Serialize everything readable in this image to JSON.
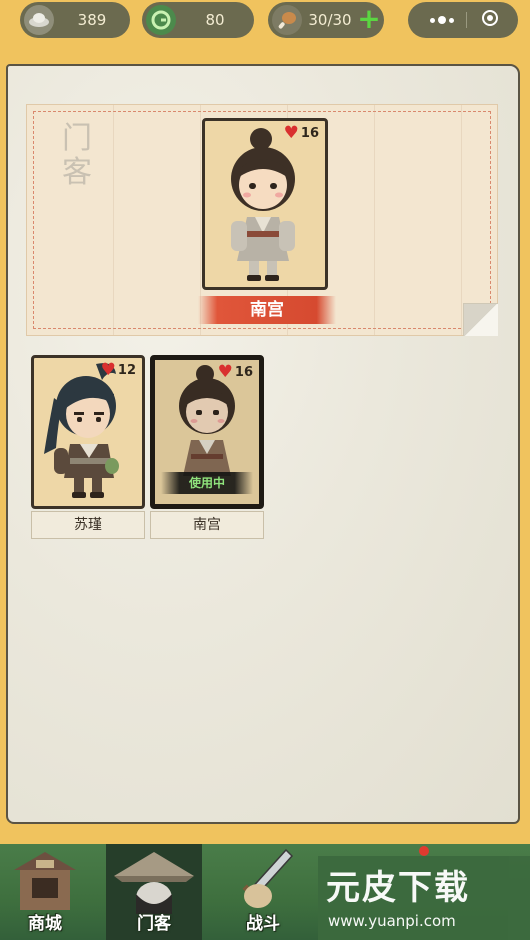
{
  "topbar": {
    "silver": "389",
    "jade": "80",
    "food": "30/30",
    "silver_icon": "silver-ingot-icon",
    "jade_icon": "jade-coin-icon",
    "food_icon": "drumstick-icon",
    "add_icon": "plus-icon"
  },
  "panel": {
    "title": "门客",
    "selected": {
      "name": "南宫",
      "hp": "16"
    }
  },
  "roster": [
    {
      "name": "苏瑾",
      "hp": "12"
    },
    {
      "name": "南宫",
      "hp": "16",
      "status": "使用中"
    }
  ],
  "nav": {
    "shop": "商城",
    "guests": "门客",
    "battle": "战斗"
  },
  "watermark": {
    "title": "元皮下载",
    "url": "www.yuanpi.com"
  },
  "colors": {
    "background": "#f0c35e",
    "pill": "#6b6a4f",
    "banner": "#d64a30",
    "nav": "#3e6f3e",
    "heart": "#d9302f",
    "inuse": "#8fe37c"
  }
}
